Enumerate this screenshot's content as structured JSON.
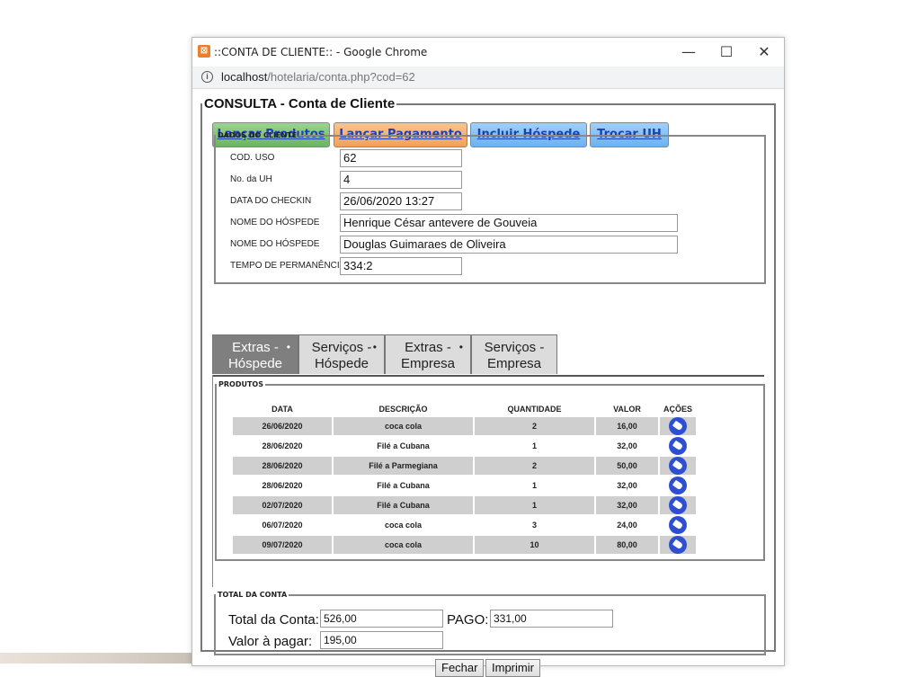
{
  "window": {
    "title": "::CONTA DE CLIENTE:: - Google Chrome",
    "url_host": "localhost",
    "url_path": "/hotelaria/conta.php?cod=62",
    "minimize": "—",
    "maximize": "☐",
    "close": "✕"
  },
  "form": {
    "legend": "CONSULTA - Conta de Cliente",
    "buttons": {
      "lancar_produtos": "Lançar Produtos",
      "lancar_pagamento": "Lançar Pagamento",
      "incluir_hospede": "Incluir Hóspede",
      "trocar_uh": "Trocar UH"
    },
    "client": {
      "legend": "DADOS DO CLIENTE",
      "fields": [
        {
          "label": "COD. USO",
          "value": "62"
        },
        {
          "label": "No. da UH",
          "value": "4"
        },
        {
          "label": "DATA DO CHECKIN",
          "value": "26/06/2020 13:27"
        },
        {
          "label": "NOME DO HÓSPEDE",
          "value": "Henrique César antevere de Gouveia"
        },
        {
          "label": "NOME DO HÓSPEDE",
          "value": "Douglas Guimaraes de Oliveira"
        },
        {
          "label": "TEMPO DE PERMANÊNCIA",
          "value": "334:2"
        }
      ]
    },
    "tabs": [
      {
        "line1": "Extras -",
        "line2": "Hóspede",
        "dot": "•"
      },
      {
        "line1": "Serviços -",
        "line2": "Hóspede",
        "dot": "•"
      },
      {
        "line1": "Extras -",
        "line2": "Empresa",
        "dot": "•"
      },
      {
        "line1": "Serviços -",
        "line2": "Empresa",
        "dot": ""
      }
    ],
    "products": {
      "legend": "PRODUTOS",
      "headers": {
        "data": "DATA",
        "descricao": "DESCRIÇÃO",
        "quantidade": "QUANTIDADE",
        "valor": "VALOR",
        "acoes": "AÇÕES"
      },
      "rows": [
        {
          "data": "26/06/2020",
          "descricao": "coca cola",
          "quantidade": "2",
          "valor": "16,00"
        },
        {
          "data": "28/06/2020",
          "descricao": "Filé a Cubana",
          "quantidade": "1",
          "valor": "32,00"
        },
        {
          "data": "28/06/2020",
          "descricao": "Filé a Parmegiana",
          "quantidade": "2",
          "valor": "50,00"
        },
        {
          "data": "28/06/2020",
          "descricao": "Filé a Cubana",
          "quantidade": "1",
          "valor": "32,00"
        },
        {
          "data": "02/07/2020",
          "descricao": "Filé a Cubana",
          "quantidade": "1",
          "valor": "32,00"
        },
        {
          "data": "06/07/2020",
          "descricao": "coca cola",
          "quantidade": "3",
          "valor": "24,00"
        },
        {
          "data": "09/07/2020",
          "descricao": "coca cola",
          "quantidade": "10",
          "valor": "80,00"
        }
      ]
    },
    "total": {
      "legend": "TOTAL DA CONTA",
      "total_label": "Total da Conta:",
      "total_value": "526,00",
      "pago_label": "PAGO:",
      "pago_value": "331,00",
      "pagar_label": "Valor à pagar:",
      "pagar_value": "195,00"
    },
    "fechar": "Fechar",
    "imprimir": "Imprimir"
  },
  "colors": {
    "btn_green": "#6bb462",
    "btn_orange": "#f0a15b",
    "btn_blue": "#6bb2f0",
    "link": "#1f3fb5",
    "active_tab": "#7f7f7f",
    "row_shade": "#cfcfcf",
    "action_icon": "#2f4fd3"
  },
  "icons": {
    "app": "xampp-icon",
    "action": "tag-icon",
    "site": "info-icon"
  }
}
